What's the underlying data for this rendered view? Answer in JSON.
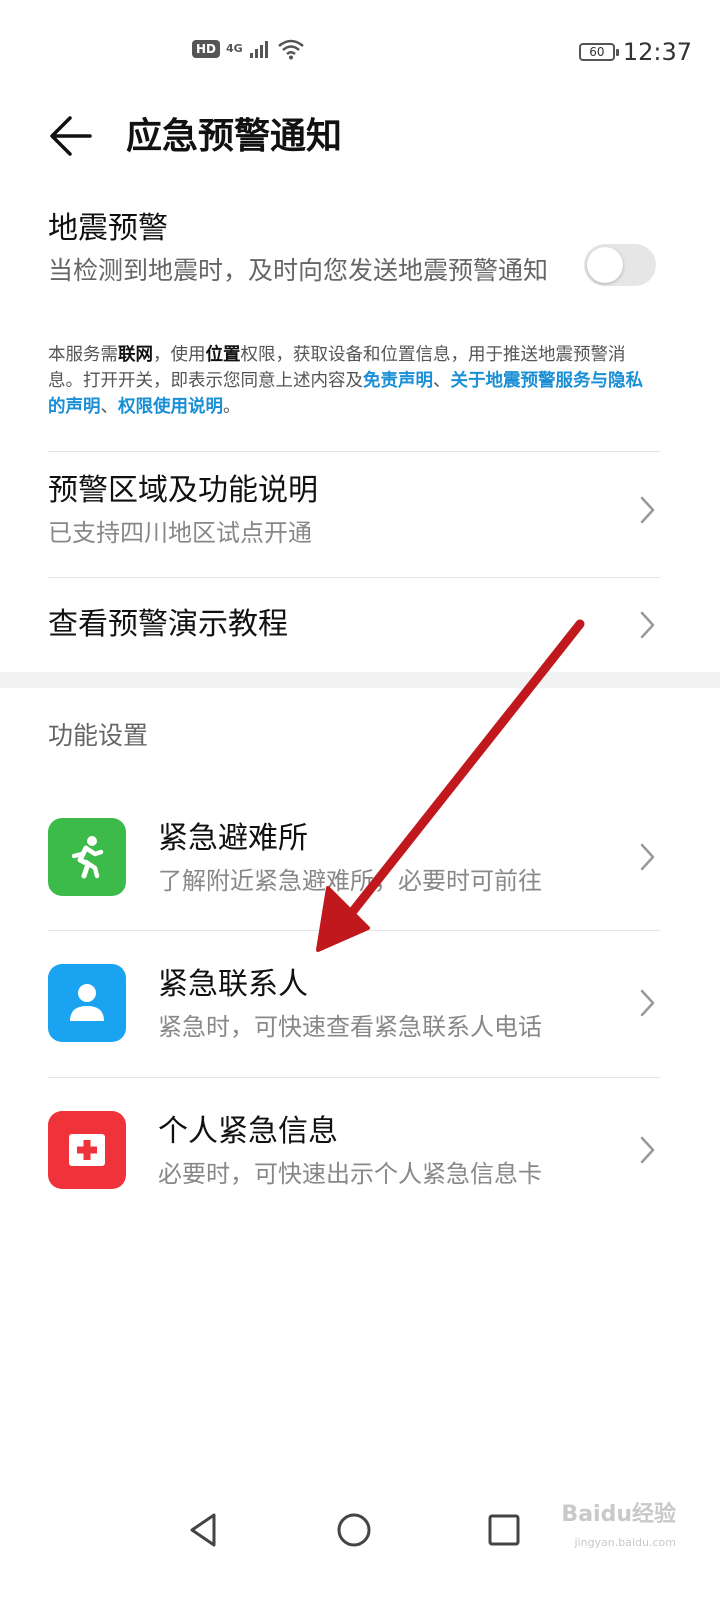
{
  "status_bar": {
    "hd_badge": "HD",
    "network": "4G",
    "signal_icon": "cellular-signal-icon",
    "wifi_icon": "wifi-icon",
    "battery_level": "60",
    "time": "12:37"
  },
  "header": {
    "back_icon": "back-arrow-icon",
    "title": "应急预警通知"
  },
  "earthquake_warning": {
    "title": "地震预警",
    "description": "当检测到地震时，及时向您发送地震预警通知",
    "toggle_on": false,
    "disclaimer": {
      "part1": "本服务需",
      "bold1": "联网",
      "part2": "，使用",
      "bold2": "位置",
      "part3": "权限，获取设备和位置信息，用于推送地震预警消息。打开开关，即表示您同意上述内容及",
      "link1": "免责声明",
      "sep1": "、",
      "link2": "关于地震预警服务与隐私的声明",
      "sep2": "、",
      "link3": "权限使用说明",
      "end": "。"
    }
  },
  "rows": [
    {
      "title": "预警区域及功能说明",
      "subtitle": "已支持四川地区试点开通"
    },
    {
      "title": "查看预警演示教程"
    }
  ],
  "function_settings": {
    "section_label": "功能设置",
    "items": [
      {
        "title": "紧急避难所",
        "subtitle": "了解附近紧急避难所，必要时可前往",
        "icon": "running-person-icon",
        "color": "#3dbb4a"
      },
      {
        "title": "紧急联系人",
        "subtitle": "紧急时，可快速查看紧急联系人电话",
        "icon": "contact-person-icon",
        "color": "#1aa3f0"
      },
      {
        "title": "个人紧急信息",
        "subtitle": "必要时，可快速出示个人紧急信息卡",
        "icon": "medical-cross-icon",
        "color": "#f0323a"
      }
    ]
  },
  "annotation": {
    "arrow_color": "#c0181c"
  },
  "nav_bar": {
    "back_icon": "nav-back-icon",
    "home_icon": "nav-home-icon",
    "recents_icon": "nav-recents-icon"
  },
  "watermark": {
    "text": "Baidu经验",
    "sub": "jingyan.baidu.com"
  }
}
